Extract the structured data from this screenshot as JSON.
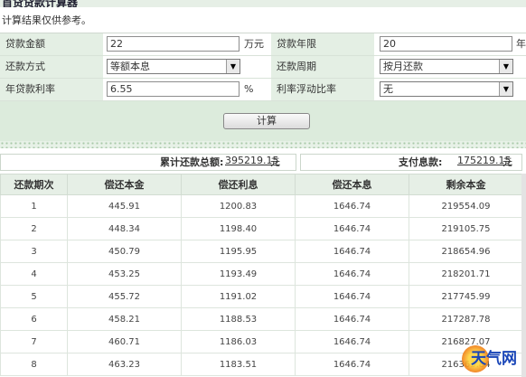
{
  "header": {
    "title": "首贷贷款计算器",
    "note": "计算结果仅供参考。"
  },
  "form": {
    "amount_label": "贷款金额",
    "amount_value": "22",
    "amount_unit": "万元",
    "term_label": "贷款年限",
    "term_value": "20",
    "term_unit": "年",
    "method_label": "还款方式",
    "method_value": "等额本息",
    "period_label": "还款周期",
    "period_value": "按月还款",
    "rate_label": "年贷款利率",
    "rate_value": "6.55",
    "rate_unit": "%",
    "float_label": "利率浮动比率",
    "float_value": "无"
  },
  "calc_button": "计算",
  "summary": {
    "total_label": "累计还款总额:",
    "total_value": "395219.15",
    "total_unit": "元",
    "interest_label": "支付息款:",
    "interest_value": "175219.15",
    "interest_unit": "元"
  },
  "table": {
    "headers": [
      "还款期次",
      "偿还本金",
      "偿还利息",
      "偿还本息",
      "剩余本金"
    ],
    "rows": [
      [
        "1",
        "445.91",
        "1200.83",
        "1646.74",
        "219554.09"
      ],
      [
        "2",
        "448.34",
        "1198.40",
        "1646.74",
        "219105.75"
      ],
      [
        "3",
        "450.79",
        "1195.95",
        "1646.74",
        "218654.96"
      ],
      [
        "4",
        "453.25",
        "1193.49",
        "1646.74",
        "218201.71"
      ],
      [
        "5",
        "455.72",
        "1191.02",
        "1646.74",
        "217745.99"
      ],
      [
        "6",
        "458.21",
        "1188.53",
        "1646.74",
        "217287.78"
      ],
      [
        "7",
        "460.71",
        "1186.03",
        "1646.74",
        "216827.07"
      ],
      [
        "8",
        "463.23",
        "1183.51",
        "1646.74",
        "216363.84"
      ]
    ]
  },
  "watermark": "天气网"
}
